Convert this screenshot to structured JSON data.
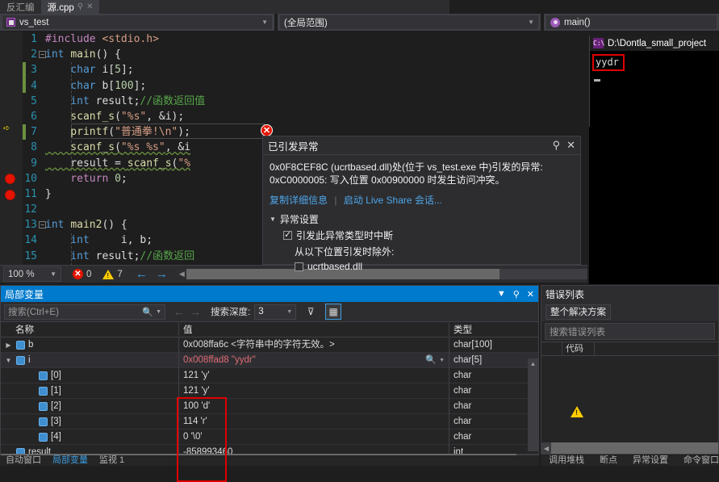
{
  "tabs": [
    {
      "label": "反汇编",
      "active": false
    },
    {
      "label": "源.cpp",
      "active": true
    }
  ],
  "navbar": {
    "project": "vs_test",
    "scope": "(全局范围)",
    "function": "main()"
  },
  "editor": {
    "lines": [
      {
        "num": "1",
        "tokens": [
          {
            "t": "#include ",
            "c": "ppk"
          },
          {
            "t": "<stdio.h>",
            "c": "str"
          }
        ]
      },
      {
        "num": "2",
        "tokens": [
          {
            "t": "int ",
            "c": "kw"
          },
          {
            "t": "main",
            "c": "fn"
          },
          {
            "t": "() {",
            "c": "pln"
          }
        ]
      },
      {
        "num": "3",
        "tokens": [
          {
            "t": "    char ",
            "c": "kw"
          },
          {
            "t": "i[",
            "c": "pln"
          },
          {
            "t": "5",
            "c": "num"
          },
          {
            "t": "];",
            "c": "pln"
          }
        ]
      },
      {
        "num": "4",
        "tokens": [
          {
            "t": "    char ",
            "c": "kw"
          },
          {
            "t": "b[",
            "c": "pln"
          },
          {
            "t": "100",
            "c": "num"
          },
          {
            "t": "];",
            "c": "pln"
          }
        ]
      },
      {
        "num": "5",
        "tokens": [
          {
            "t": "    int ",
            "c": "kw"
          },
          {
            "t": "result;",
            "c": "pln"
          },
          {
            "t": "//函数返回值",
            "c": "cmt"
          }
        ]
      },
      {
        "num": "6",
        "tokens": [
          {
            "t": "    scanf_s",
            "c": "fn"
          },
          {
            "t": "(",
            "c": "pln"
          },
          {
            "t": "\"%s\"",
            "c": "str"
          },
          {
            "t": ", &i);",
            "c": "pln"
          }
        ]
      },
      {
        "num": "7",
        "tokens": [
          {
            "t": "    printf",
            "c": "fn"
          },
          {
            "t": "(",
            "c": "pln"
          },
          {
            "t": "\"普通拳!\\n\"",
            "c": "str"
          },
          {
            "t": ");",
            "c": "pln"
          }
        ]
      },
      {
        "num": "8",
        "tokens": [
          {
            "t": "    scanf_s",
            "c": "fn"
          },
          {
            "t": "(",
            "c": "pln"
          },
          {
            "t": "\"%s %s\"",
            "c": "str"
          },
          {
            "t": ", &i",
            "c": "pln"
          }
        ]
      },
      {
        "num": "9",
        "tokens": [
          {
            "t": "    result = ",
            "c": "pln"
          },
          {
            "t": "scanf_s",
            "c": "fn"
          },
          {
            "t": "(",
            "c": "pln"
          },
          {
            "t": "\"%",
            "c": "str"
          }
        ]
      },
      {
        "num": "10",
        "tokens": [
          {
            "t": "    return ",
            "c": "ppk"
          },
          {
            "t": "0",
            "c": "num"
          },
          {
            "t": ";",
            "c": "pln"
          }
        ]
      },
      {
        "num": "11",
        "tokens": [
          {
            "t": "}",
            "c": "pln"
          }
        ]
      },
      {
        "num": "12",
        "tokens": []
      },
      {
        "num": "13",
        "tokens": [
          {
            "t": "int ",
            "c": "kw"
          },
          {
            "t": "main2",
            "c": "fn"
          },
          {
            "t": "() {",
            "c": "pln"
          }
        ]
      },
      {
        "num": "14",
        "tokens": [
          {
            "t": "    int ",
            "c": "kw"
          },
          {
            "t": "    i, b;",
            "c": "pln"
          }
        ]
      },
      {
        "num": "15",
        "tokens": [
          {
            "t": "    int ",
            "c": "kw"
          },
          {
            "t": "result;",
            "c": "pln"
          },
          {
            "t": "//函数返回",
            "c": "cmt"
          }
        ]
      }
    ],
    "error_marker": "✕"
  },
  "editor_status": {
    "zoom": "100 %",
    "error_count": "0",
    "warning_count": "7",
    "back_arrow": "←",
    "forward_arrow": "→"
  },
  "exception": {
    "title": "已引发异常",
    "message_line1": "0x0F8CEF8C (ucrtbased.dll)处(位于 vs_test.exe 中)引发的异常:",
    "message_line2": "0xC0000005: 写入位置 0x00900000 时发生访问冲突。",
    "link_copy": "复制详细信息",
    "link_liveshare": "启动 Live Share 会话...",
    "settings_header": "异常设置",
    "setting_break": "引发此异常类型时中断",
    "setting_except_label": "从以下位置引发时除外:",
    "setting_dll": "ucrtbased.dll",
    "pin": "⚲",
    "close": "✕"
  },
  "console": {
    "title": "D:\\Dontla_small_project",
    "output": "yydr"
  },
  "locals": {
    "title": "局部变量",
    "search_placeholder": "搜索(Ctrl+E)",
    "depth_label": "搜索深度:",
    "depth_value": "3",
    "columns": [
      "名称",
      "值",
      "类型"
    ],
    "rows": [
      {
        "indent": 0,
        "expander": "▶",
        "name": "b",
        "value": "0x008ffa6c <字符串中的字符无效。>",
        "type": "char[100]",
        "modified": false,
        "selected": false,
        "magnifier": false
      },
      {
        "indent": 0,
        "expander": "▼",
        "name": "i",
        "value": "0x008ffad8 \"yydr\"",
        "type": "char[5]",
        "modified": true,
        "selected": true,
        "magnifier": true
      },
      {
        "indent": 1,
        "expander": "",
        "name": "[0]",
        "value": "121 'y'",
        "type": "char",
        "modified": false,
        "selected": false,
        "magnifier": false
      },
      {
        "indent": 1,
        "expander": "",
        "name": "[1]",
        "value": "121 'y'",
        "type": "char",
        "modified": false,
        "selected": false,
        "magnifier": false
      },
      {
        "indent": 1,
        "expander": "",
        "name": "[2]",
        "value": "100 'd'",
        "type": "char",
        "modified": false,
        "selected": false,
        "magnifier": false
      },
      {
        "indent": 1,
        "expander": "",
        "name": "[3]",
        "value": "114 'r'",
        "type": "char",
        "modified": false,
        "selected": false,
        "magnifier": false
      },
      {
        "indent": 1,
        "expander": "",
        "name": "[4]",
        "value": "0 '\\0'",
        "type": "char",
        "modified": false,
        "selected": false,
        "magnifier": false
      },
      {
        "indent": 0,
        "expander": "",
        "name": "result",
        "value": "-858993460",
        "type": "int",
        "modified": false,
        "selected": false,
        "magnifier": false
      }
    ]
  },
  "error_list": {
    "title": "错误列表",
    "scope_filter": "整个解决方案",
    "search_placeholder": "搜索错误列表",
    "col_code": "代码",
    "rows": [
      {
        "severity": "warning"
      },
      {
        "severity": "warning"
      }
    ]
  },
  "bottom_tabs": [
    {
      "label": "自动窗口",
      "active": false
    },
    {
      "label": "局部变量",
      "active": true
    },
    {
      "label": "监视 1",
      "active": false
    }
  ],
  "bottom_right_items": [
    {
      "label": "调用堆栈"
    },
    {
      "label": "断点"
    },
    {
      "label": "异常设置"
    },
    {
      "label": "命令窗口"
    }
  ],
  "colors": {
    "accent_blue": "#007acc",
    "link_blue": "#4ea6ea",
    "breakpoint_red": "#e51400",
    "highlight_red": "#e00000",
    "warning_yellow": "#ffcc00",
    "keyword_blue": "#569cd6",
    "string_orange": "#d69d85",
    "comment_green": "#57a64a"
  }
}
